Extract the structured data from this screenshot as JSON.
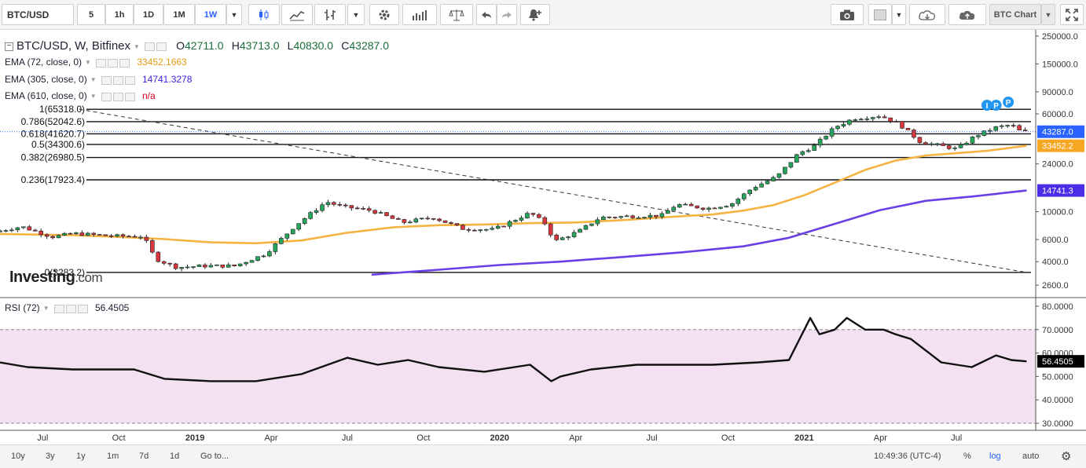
{
  "toolbar": {
    "symbol": "BTC/USD",
    "intervals": [
      "5",
      "1h",
      "1D",
      "1M",
      "1W"
    ],
    "active_interval": "1W",
    "layout_label": "BTC Chart"
  },
  "legend": {
    "title": "BTC/USD, W, Bitfinex",
    "o_label": "O",
    "o_value": "42711.0",
    "h_label": "H",
    "h_value": "43713.0",
    "l_label": "L",
    "l_value": "40830.0",
    "c_label": "C",
    "c_value": "43287.0",
    "ema72_label": "EMA (72, close, 0)",
    "ema72_value": "33452.1663",
    "ema305_label": "EMA (305, close, 0)",
    "ema305_value": "14741.3278",
    "ema610_label": "EMA (610, close, 0)",
    "ema610_value": "n/a",
    "rsi_label": "RSI (72)",
    "rsi_value": "56.4505"
  },
  "watermark": {
    "bold": "Investing",
    "light": ".com"
  },
  "price_axis_labels": [
    "250000.0",
    "150000.0",
    "90000.0",
    "60000.0",
    "24000.0",
    "10000.0",
    "6000.0",
    "4000.0",
    "2600.0"
  ],
  "price_axis_values": [
    250000,
    150000,
    90000,
    60000,
    24000,
    10000,
    6000,
    4000,
    2600
  ],
  "price_tags": [
    {
      "label": "43287.0",
      "value": 43287,
      "color": "#2962ff"
    },
    {
      "label": "33452.2",
      "value": 33452,
      "color": "#f5a623"
    },
    {
      "label": "14741.3",
      "value": 14741,
      "color": "#4a2ee6"
    }
  ],
  "rsi_axis_labels": [
    "80.0000",
    "70.0000",
    "60.0000",
    "50.0000",
    "40.0000",
    "30.0000"
  ],
  "rsi_axis_values": [
    80,
    70,
    60,
    50,
    40,
    30
  ],
  "rsi_tag": {
    "label": "56.4505",
    "value": 56.45
  },
  "time_axis_labels": [
    {
      "label": "Jul",
      "x": 2018.5,
      "bold": false
    },
    {
      "label": "Oct",
      "x": 2018.75,
      "bold": false
    },
    {
      "label": "2019",
      "x": 2019.0,
      "bold": true
    },
    {
      "label": "Apr",
      "x": 2019.25,
      "bold": false
    },
    {
      "label": "Jul",
      "x": 2019.5,
      "bold": false
    },
    {
      "label": "Oct",
      "x": 2019.75,
      "bold": false
    },
    {
      "label": "2020",
      "x": 2020.0,
      "bold": true
    },
    {
      "label": "Apr",
      "x": 2020.25,
      "bold": false
    },
    {
      "label": "Jul",
      "x": 2020.5,
      "bold": false
    },
    {
      "label": "Oct",
      "x": 2020.75,
      "bold": false
    },
    {
      "label": "2021",
      "x": 2021.0,
      "bold": true
    },
    {
      "label": "Apr",
      "x": 2021.25,
      "bold": false
    },
    {
      "label": "Jul",
      "x": 2021.5,
      "bold": false
    }
  ],
  "bottom": {
    "ranges": [
      "10y",
      "3y",
      "1y",
      "1m",
      "7d",
      "1d"
    ],
    "goto": "Go to...",
    "time": "10:49:36 (UTC-4)",
    "percent": "%",
    "log": "log",
    "auto": "auto"
  },
  "chart_data": {
    "type": "candlestick",
    "title": "BTC/USD, W, Bitfinex",
    "y_scale": "log",
    "xlim": [
      2018.36,
      2021.76
    ],
    "ylim": [
      2100,
      280000
    ],
    "fibonacci": [
      {
        "label": "1(65318.0)",
        "value": 65318.0
      },
      {
        "label": "0.786(52042.6)",
        "value": 52042.6
      },
      {
        "label": "0.618(41620.7)",
        "value": 41620.7
      },
      {
        "label": "0.5(34300.6)",
        "value": 34300.6
      },
      {
        "label": "0.382(26980.5)",
        "value": 26980.5
      },
      {
        "label": "0.236(17923.4)",
        "value": 17923.4
      },
      {
        "label": "0(3283.2)",
        "value": 3283.2
      }
    ],
    "trendline": {
      "from": [
        2018.62,
        65318
      ],
      "to": [
        2021.73,
        3283
      ]
    },
    "series": [
      {
        "name": "EMA (72, close, 0)",
        "color": "#f5b342",
        "x": [
          2018.36,
          2018.6,
          2018.75,
          2018.9,
          2019.05,
          2019.2,
          2019.35,
          2019.5,
          2019.65,
          2019.8,
          2019.95,
          2020.1,
          2020.25,
          2020.4,
          2020.55,
          2020.7,
          2020.8,
          2020.9,
          2021.0,
          2021.1,
          2021.2,
          2021.3,
          2021.4,
          2021.5,
          2021.6,
          2021.73
        ],
        "values": [
          6650,
          6500,
          6300,
          6050,
          5700,
          5600,
          5900,
          6800,
          7500,
          7800,
          7900,
          8100,
          8200,
          8550,
          9050,
          9500,
          10200,
          11300,
          13500,
          17000,
          21500,
          25500,
          28000,
          29200,
          30500,
          33452
        ]
      },
      {
        "name": "EMA (305, close, 0)",
        "color": "#6b3fe6",
        "x": [
          2019.58,
          2019.8,
          2020.0,
          2020.2,
          2020.4,
          2020.6,
          2020.8,
          2020.95,
          2021.1,
          2021.25,
          2021.4,
          2021.55,
          2021.73
        ],
        "values": [
          3150,
          3450,
          3760,
          4000,
          4350,
          4750,
          5300,
          6200,
          8000,
          10300,
          12200,
          13200,
          14741
        ]
      },
      {
        "name": "RSI (72)",
        "color": "#111111",
        "x": [
          2018.36,
          2018.45,
          2018.6,
          2018.8,
          2018.9,
          2019.05,
          2019.2,
          2019.35,
          2019.5,
          2019.6,
          2019.7,
          2019.8,
          2019.95,
          2020.1,
          2020.17,
          2020.2,
          2020.3,
          2020.45,
          2020.6,
          2020.7,
          2020.85,
          2020.95,
          2021.02,
          2021.05,
          2021.1,
          2021.14,
          2021.2,
          2021.26,
          2021.3,
          2021.35,
          2021.45,
          2021.55,
          2021.63,
          2021.68,
          2021.73
        ],
        "values": [
          56,
          54,
          53,
          53,
          49,
          48,
          48,
          51,
          58,
          55,
          57,
          54,
          52,
          55,
          48,
          50,
          53,
          55,
          55,
          55,
          56,
          57,
          75,
          68,
          70,
          75,
          70,
          70,
          68,
          66,
          56,
          54,
          59,
          57,
          56.45
        ]
      }
    ],
    "rsi_range": [
      27,
      83
    ],
    "rsi_bands": [
      70,
      30
    ]
  }
}
